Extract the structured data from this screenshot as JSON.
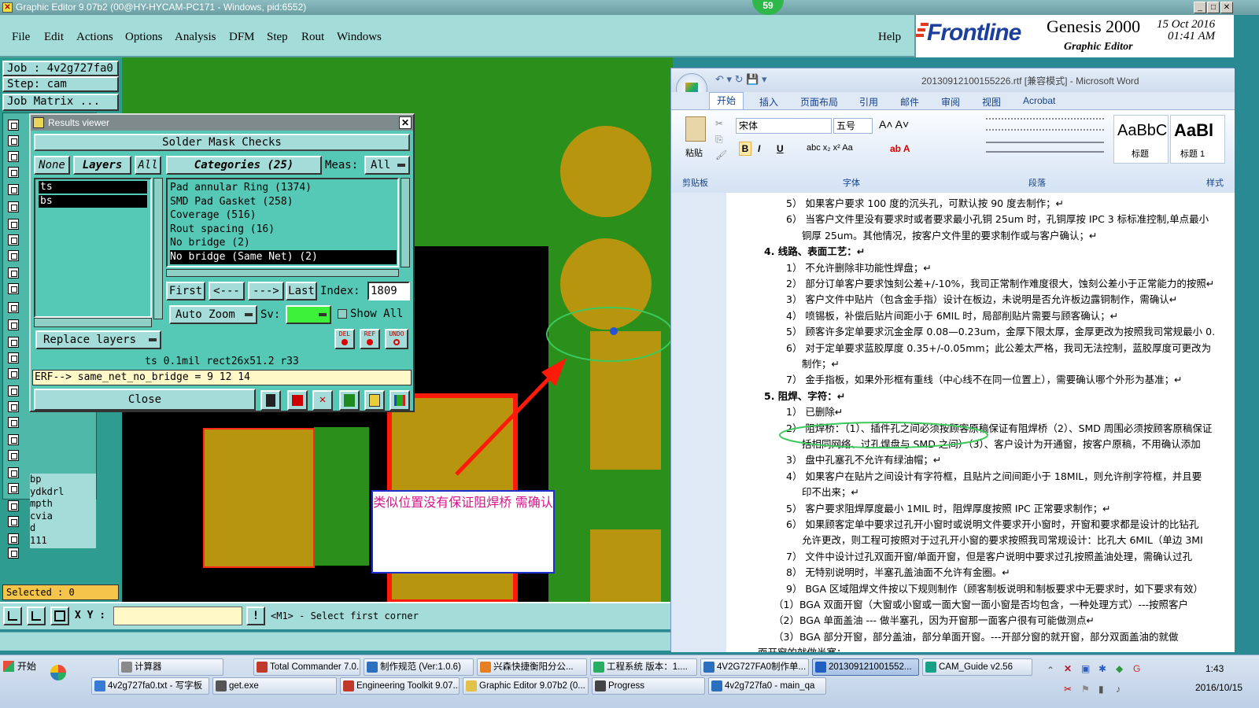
{
  "titlebar": {
    "text": "Graphic Editor 9.07b2 (00@HY-HYCAM-PC171 - Windows, pid:6552)",
    "badge": "59"
  },
  "menu": [
    "File",
    "Edit",
    "Actions",
    "Options",
    "Analysis",
    "DFM",
    "Step",
    "Rout",
    "Windows"
  ],
  "help": "Help",
  "brand": {
    "logo": "Frontline",
    "product": "Genesis 2000",
    "sub": "Graphic Editor",
    "date": "15 Oct 2016",
    "time": "01:41 AM"
  },
  "left": {
    "job": "Job : 4v2g727fa0",
    "step": "Step: cam",
    "job_matrix": "Job Matrix ...",
    "layers": [
      "bp",
      "ydkdrl",
      "mpth",
      "cvia",
      "d",
      "111"
    ],
    "selected": "Selected : 0"
  },
  "results": {
    "title": "Results viewer",
    "header": "Solder Mask Checks",
    "none": "None",
    "layers_btn": "Layers",
    "all": "All",
    "categories": "Categories (25)",
    "meas_label": "Meas:",
    "meas_value": "All",
    "layer_list": [
      "ts",
      "bs"
    ],
    "cat_list": [
      "Pad annular Ring (1374)",
      "SMD Pad Gasket (258)",
      "Coverage (516)",
      "Rout spacing (16)",
      "No bridge (2)",
      "No bridge (Same Net) (2)"
    ],
    "first": "First",
    "prev": "<---",
    "next": "--->",
    "last": "Last",
    "index_label": "Index:",
    "index_value": "1809",
    "auto_zoom": "Auto Zoom",
    "sv": "Sv:",
    "show_all": "Show All",
    "replace": "Replace layers",
    "del": "DEL",
    "ref": "REF",
    "undo": "UNDO",
    "info": "ts 0.1mil   rect26x51.2   r33",
    "erf": "ERF--> same_net_no_bridge = 9 12 14",
    "close": "Close"
  },
  "annotation": "类似位置没有保证阻焊桥 需确认",
  "status": {
    "xy_label": "X Y :",
    "prompt": "<M1> - Select first corner"
  },
  "word": {
    "title": "20130912100155226.rtf [兼容模式] - Microsoft Word",
    "tabs": [
      "开始",
      "插入",
      "页面布局",
      "引用",
      "邮件",
      "审阅",
      "视图",
      "Acrobat"
    ],
    "font": "宋体",
    "size": "五号",
    "groups": [
      "剪贴板",
      "字体",
      "段落",
      "样式"
    ],
    "paste": "粘贴",
    "styles": [
      "AaBbC",
      "AaBl"
    ],
    "style_names": [
      "标题",
      "标题 1"
    ],
    "lines": [
      "5） 如果客户要求 100 度的沉头孔，可默认按 90 度去制作；↵",
      "6） 当客户文件里没有要求时或者要求最小孔铜 25um 时，孔铜厚按 IPC 3 标标准控制,单点最小",
      "铜厚 25um。其他情况，按客户文件里的要求制作或与客户确认；↵",
      "4.  线路、表面工艺：↵",
      "1） 不允许删除非功能性焊盘；↵",
      "2） 部分订单客户要求蚀刻公差+/-10%，我司正常制作难度很大，蚀刻公差小于正常能力的按照↵",
      "3） 客户文件中贴片（包含金手指）设计在板边，未说明是否允许板边露铜制作，需确认↵",
      "4） 喷锡板，补偿后贴片间距小于 6MIL 时，局部削贴片需要与顾客确认；↵",
      "5） 顾客许多定单要求沉金金厚 0.08—0.23um，金厚下限太厚，金厚更改为按照我司常规最小 0.",
      "6） 对于定单要求蓝胶厚度 0.35+/-0.05mm；此公差太严格，我司无法控制，蓝胶厚度可更改为",
      "制作；↵",
      "7） 金手指板，如果外形框有重线（中心线不在同一位置上），需要确认哪个外形为基准；↵",
      "5.  阻焊、字符：↵",
      "1） 已删除↵",
      "2） 阻焊桥：（1）、插件孔之间必须按顾客原稿保证有阻焊桥（2）、SMD 周围必须按顾客原稿保证",
      "括相同网络、过孔焊盘与 SMD 之间）（3）、客户设计为开通窗，按客户原稿，不用确认添加",
      "3） 盘中孔塞孔不允许有绿油帽；↵",
      "4） 如果客户在贴片之间设计有字符框，且贴片之间间距小于 18MIL，则允许削字符框，并且要",
      "印不出来；↵",
      "5） 客户要求阻焊厚度最小 1MIL 时，阻焊厚度按照 IPC 正常要求制作；↵",
      "6） 如果顾客定单中要求过孔开小窗时或说明文件要求开小窗时，开窗和要求都是设计的比钻孔",
      "允许更改，则工程可按照对于过孔开小窗的要求按照我司常规设计：比孔大 6MIL（单边 3MI",
      "7） 文件中设计过孔双面开窗/单面开窗，但是客户说明中要求过孔按照盖油处理，需确认过孔",
      "8） 无特别说明时，半塞孔盖油面不允许有金圈。↵",
      "9） BGA 区域阻焊文件按以下规则制作（顾客制板说明和制板要求中无要求时，如下要求有效）",
      "（1）BGA 双面开窗（大窗或小窗或一面大窗一面小窗是否均包含，一种处理方式）---按照客户",
      "（2）BGA 单面盖油 --- 做半塞孔，因为开窗那一面客户很有可能做测点↵",
      "（3）BGA 部分开窗，部分盖油，部分单面开窗。---开部分窗的就开窗，部分双面盖油的就做",
      "面开窗的就做半塞；"
    ]
  },
  "taskbar": {
    "start": "开始",
    "row1": [
      "计算器",
      "Total Commander 7.0...",
      "制作规范 (Ver:1.0.6)",
      "兴森快捷衡阳分公...",
      "工程系统  版本：1....",
      "4V2G727FA0制作单...",
      "201309121001552...",
      "CAM_Guide v2.56"
    ],
    "row2": [
      "4v2g727fa0.txt - 写字板",
      "get.exe",
      "Engineering Toolkit 9.07...",
      "Graphic Editor 9.07b2 (0...",
      "Progress",
      "4v2g727fa0 - main_qa"
    ],
    "clock_time": "1:43",
    "clock_date": "2016/10/15"
  },
  "colors": {
    "pcb_green": "#2b8f1c",
    "pad_gold": "#b8950f",
    "teal": "#a3dcd8",
    "panel": "#55c8b6"
  }
}
